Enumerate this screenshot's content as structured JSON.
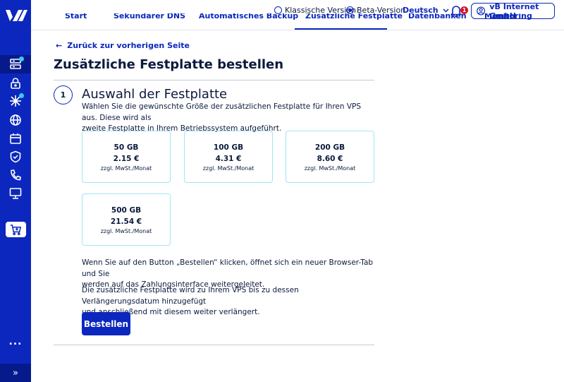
{
  "topbar": {
    "classic_label": "Klassische Version",
    "beta_label": "Beta-Version",
    "language": "Deutsch",
    "notification_count": "1",
    "account_name": "vB Internet GmbH"
  },
  "tabs": [
    {
      "label": "Start"
    },
    {
      "label": "Sekundärer DNS"
    },
    {
      "label": "Automatisches Backup"
    },
    {
      "label": "Zusätzliche Festplatte"
    },
    {
      "label": "Datenbanken"
    },
    {
      "label": "Monitoring"
    }
  ],
  "main": {
    "back_label": "Zurück zur vorherigen Seite",
    "title": "Zusätzliche Festplatte bestellen",
    "step_number": "1",
    "section_title": "Auswahl der Festplatte",
    "intro_line1": "Wählen Sie die gewünschte Größe der zusätzlichen Festplatte für Ihren VPS aus. Diese wird als",
    "intro_line2": "zweite Festplatte in Ihrem Betriebssystem aufgeführt.",
    "disks": [
      {
        "size": "50 GB",
        "price": "2.15 €",
        "tax": "zzgl. MwSt./Monat"
      },
      {
        "size": "100 GB",
        "price": "4.31 €",
        "tax": "zzgl. MwSt./Monat"
      },
      {
        "size": "200 GB",
        "price": "8.60 €",
        "tax": "zzgl. MwSt./Monat"
      },
      {
        "size": "500 GB",
        "price": "21.54 €",
        "tax": "zzgl. MwSt./Monat"
      }
    ],
    "info1_line1": "Wenn Sie auf den Button „Bestellen“ klicken, öffnet sich ein neuer Browser-Tab und Sie",
    "info1_line2": "werden auf das Zahlungsinterface weitergeleitet.",
    "info2_line1": "Die zusätzliche Festplatte wird zu Ihrem VPS bis zu dessen Verlängerungsdatum hinzugefügt",
    "info2_line2": "und anschließend mit diesem weiter verlängert.",
    "order_button": "Bestellen"
  },
  "sidebar": {
    "icons": [
      "server-icon",
      "lock-icon",
      "network-icon",
      "globe-icon",
      "calendar-icon",
      "shield-icon",
      "phone-icon",
      "monitor-icon",
      "cart-icon"
    ],
    "more_label": "...",
    "expand_label": "»"
  },
  "colors": {
    "brand": "#0b27bd",
    "accent": "#3cc9f5",
    "card_border": "#9fe6f4",
    "alert": "#d8142b"
  }
}
